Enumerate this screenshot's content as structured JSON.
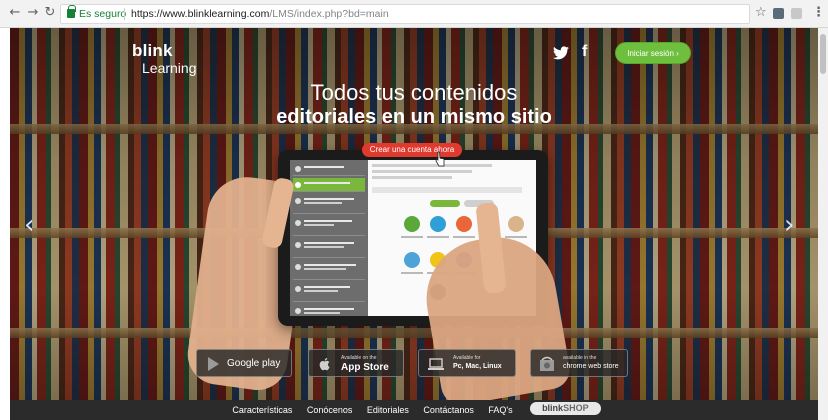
{
  "browser": {
    "secure_label": "Es seguro",
    "url_host": "https://www.blinklearning.com",
    "url_path": "/LMS/index.php?bd=main"
  },
  "icons": {
    "back": "back-arrow-icon",
    "forward": "forward-arrow-icon",
    "reload": "reload-icon",
    "bookmark": "star-icon",
    "menu": "more-vert-icon"
  },
  "colors": {
    "login_green": "#6fbf3f",
    "cta_red": "#e03a2f",
    "footer_bg": "#2b2b2b"
  },
  "header": {
    "logo_line1": "blink",
    "logo_line2": "Learning",
    "login_label": "Iniciar sesión ›"
  },
  "hero": {
    "title_line1": "Todos tus contenidos",
    "title_line2": "editoriales en un mismo sitio",
    "cta_label": "Crear una cuenta ahora"
  },
  "badges": {
    "google_play": "Google play",
    "app_store_small": "Available on the",
    "app_store": "App Store",
    "desktop_small": "Available for",
    "desktop": "Pc, Mac, Linux",
    "chrome_small": "available in the",
    "chrome": "chrome web store"
  },
  "footer": {
    "links": [
      "Características",
      "Conócenos",
      "Editoriales",
      "Contáctanos",
      "FAQ's"
    ],
    "logo_text": "blink",
    "logo_shop": "SHOP"
  }
}
